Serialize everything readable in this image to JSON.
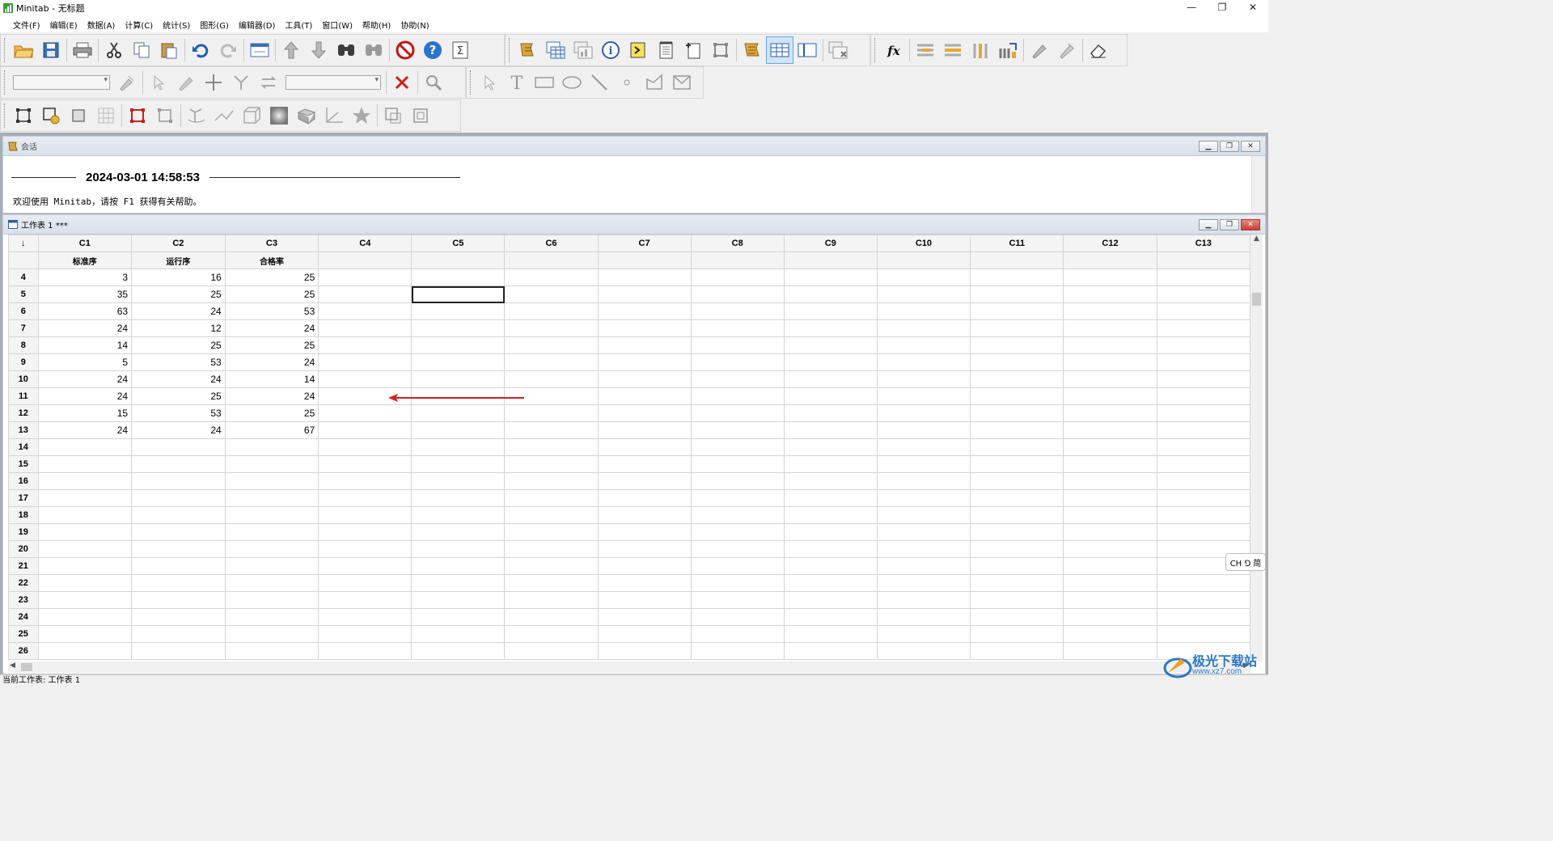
{
  "window": {
    "title": "Minitab - 无标题",
    "minimize": "—",
    "maximize": "❐",
    "close": "✕"
  },
  "menu": [
    "文件(F)",
    "编辑(E)",
    "数据(A)",
    "计算(C)",
    "统计(S)",
    "图形(G)",
    "编辑器(D)",
    "工具(T)",
    "窗口(W)",
    "帮助(H)",
    "协助(N)"
  ],
  "session": {
    "title": "会话",
    "date": "2024-03-01 14:58:53",
    "welcome": "欢迎使用 Minitab，请按 F1 获得有关帮助。"
  },
  "worksheet": {
    "title": "工作表 1 ***",
    "corner": "↓",
    "columns": [
      "C1",
      "C2",
      "C3",
      "C4",
      "C5",
      "C6",
      "C7",
      "C8",
      "C9",
      "C10",
      "C11",
      "C12",
      "C13"
    ],
    "names": [
      "标准序",
      "运行序",
      "合格率",
      "",
      "",
      "",
      "",
      "",
      "",
      "",
      "",
      "",
      ""
    ],
    "rows": [
      {
        "n": "4",
        "c1": "3",
        "c2": "16",
        "c3": "25"
      },
      {
        "n": "5",
        "c1": "35",
        "c2": "25",
        "c3": "25"
      },
      {
        "n": "6",
        "c1": "63",
        "c2": "24",
        "c3": "53"
      },
      {
        "n": "7",
        "c1": "24",
        "c2": "12",
        "c3": "24"
      },
      {
        "n": "8",
        "c1": "14",
        "c2": "25",
        "c3": "25"
      },
      {
        "n": "9",
        "c1": "5",
        "c2": "53",
        "c3": "24"
      },
      {
        "n": "10",
        "c1": "24",
        "c2": "24",
        "c3": "14"
      },
      {
        "n": "11",
        "c1": "24",
        "c2": "25",
        "c3": "24"
      },
      {
        "n": "12",
        "c1": "15",
        "c2": "53",
        "c3": "25"
      },
      {
        "n": "13",
        "c1": "24",
        "c2": "24",
        "c3": "67"
      },
      {
        "n": "14",
        "c1": "",
        "c2": "",
        "c3": ""
      },
      {
        "n": "15",
        "c1": "",
        "c2": "",
        "c3": ""
      },
      {
        "n": "16",
        "c1": "",
        "c2": "",
        "c3": ""
      },
      {
        "n": "17",
        "c1": "",
        "c2": "",
        "c3": ""
      },
      {
        "n": "18",
        "c1": "",
        "c2": "",
        "c3": ""
      },
      {
        "n": "19",
        "c1": "",
        "c2": "",
        "c3": ""
      },
      {
        "n": "20",
        "c1": "",
        "c2": "",
        "c3": ""
      },
      {
        "n": "21",
        "c1": "",
        "c2": "",
        "c3": ""
      },
      {
        "n": "22",
        "c1": "",
        "c2": "",
        "c3": ""
      },
      {
        "n": "23",
        "c1": "",
        "c2": "",
        "c3": ""
      },
      {
        "n": "24",
        "c1": "",
        "c2": "",
        "c3": ""
      },
      {
        "n": "25",
        "c1": "",
        "c2": "",
        "c3": ""
      },
      {
        "n": "26",
        "c1": "",
        "c2": "",
        "c3": ""
      }
    ],
    "selected_row": "5",
    "selected_col": "C5"
  },
  "ime": "CH ⅁ 简",
  "status": "当前工作表: 工作表 1",
  "watermark": {
    "main": "极光下载站",
    "url": "www.xz7.com"
  },
  "colors": {
    "accent_red": "#d21f1f",
    "app_green": "#3a9a3a",
    "selection_border": "#222222"
  }
}
